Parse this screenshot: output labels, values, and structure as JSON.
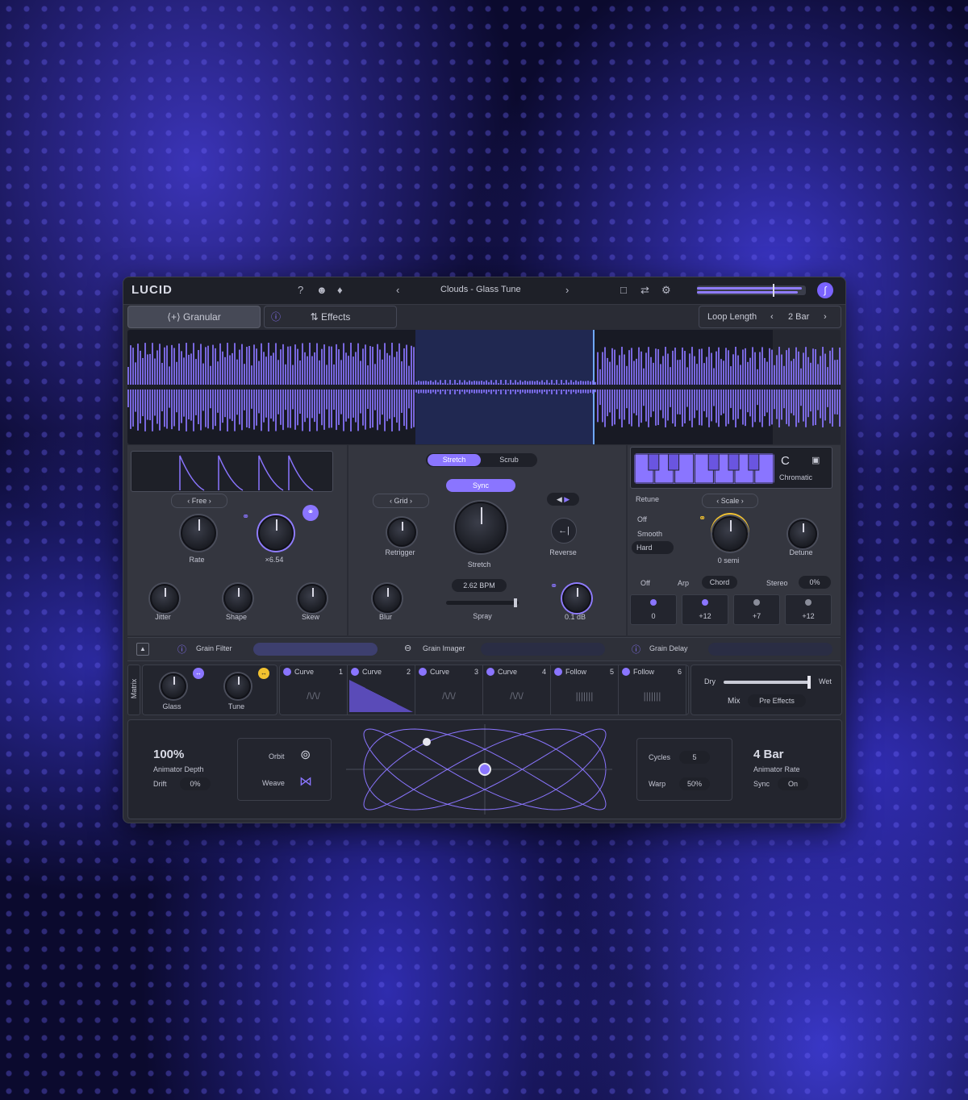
{
  "app": {
    "logo": "LUCID",
    "preset": "Clouds - Glass Tune"
  },
  "tabs": {
    "granular": "Granular",
    "effects": "Effects"
  },
  "loop": {
    "label": "Loop Length",
    "value": "2 Bar"
  },
  "left": {
    "mode": "Free",
    "rate_label": "Rate",
    "mult_label": "×6.54",
    "jitter": "Jitter",
    "shape": "Shape",
    "skew": "Skew"
  },
  "mid": {
    "stretch": "Stretch",
    "scrub": "Scrub",
    "sync": "Sync",
    "grid": "Grid",
    "retrigger": "Retrigger",
    "stretch_knob": "Stretch",
    "reverse": "Reverse",
    "bpm": "2.62 BPM",
    "blur": "Blur",
    "spray": "Spray",
    "gain": "0.1 dB"
  },
  "right": {
    "note": "C",
    "scale_name": "Chromatic",
    "retune": "Retune",
    "scale": "Scale",
    "off": "Off",
    "smooth": "Smooth",
    "hard": "Hard",
    "semi": "0 semi",
    "detune": "Detune",
    "arp_off": "Off",
    "arp": "Arp",
    "chord": "Chord",
    "stereo": "Stereo",
    "stereo_val": "0%",
    "steps": [
      "0",
      "+12",
      "+7",
      "+12"
    ]
  },
  "grain": {
    "filter": "Grain Filter",
    "imager": "Grain Imager",
    "delay": "Grain Delay"
  },
  "matrix": {
    "label": "Matrix",
    "glass": "Glass",
    "tune": "Tune",
    "slots": [
      {
        "name": "Curve",
        "n": "1"
      },
      {
        "name": "Curve",
        "n": "2"
      },
      {
        "name": "Curve",
        "n": "3"
      },
      {
        "name": "Curve",
        "n": "4"
      },
      {
        "name": "Follow",
        "n": "5"
      },
      {
        "name": "Follow",
        "n": "6"
      }
    ],
    "dry": "Dry",
    "wet": "Wet",
    "mix": "Mix",
    "pre": "Pre Effects"
  },
  "animator": {
    "depth_val": "100%",
    "depth_label": "Animator Depth",
    "drift": "Drift",
    "drift_val": "0%",
    "orbit": "Orbit",
    "weave": "Weave",
    "cycles": "Cycles",
    "cycles_val": "5",
    "warp": "Warp",
    "warp_val": "50%",
    "rate_val": "4 Bar",
    "rate_label": "Animator Rate",
    "sync": "Sync",
    "sync_val": "On"
  },
  "colors": {
    "accent": "#8a75ff",
    "panel": "#2a2c35",
    "bg": "#0b0a2e",
    "yellow": "#f2c230"
  }
}
